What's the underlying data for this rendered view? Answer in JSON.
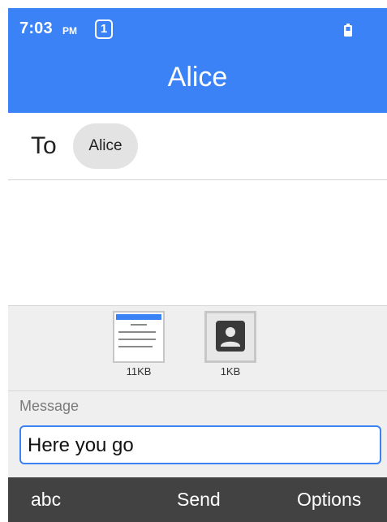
{
  "status_bar": {
    "time": "7:03",
    "ampm": "PM",
    "notification_count": "1",
    "icons": [
      "battery-icon"
    ]
  },
  "header": {
    "title": "Alice"
  },
  "to_row": {
    "label": "To",
    "recipient": "Alice"
  },
  "attachments": [
    {
      "icon": "screenshot-thumbnail",
      "size": "11KB"
    },
    {
      "icon": "contact-card-icon",
      "size": "1KB"
    }
  ],
  "message": {
    "label": "Message",
    "value": "Here you go"
  },
  "softkeys": {
    "left": "abc",
    "center": "Send",
    "right": "Options"
  },
  "colors": {
    "accent": "#3b82f6",
    "softkey_bar": "#424242",
    "panel": "#efefef"
  }
}
